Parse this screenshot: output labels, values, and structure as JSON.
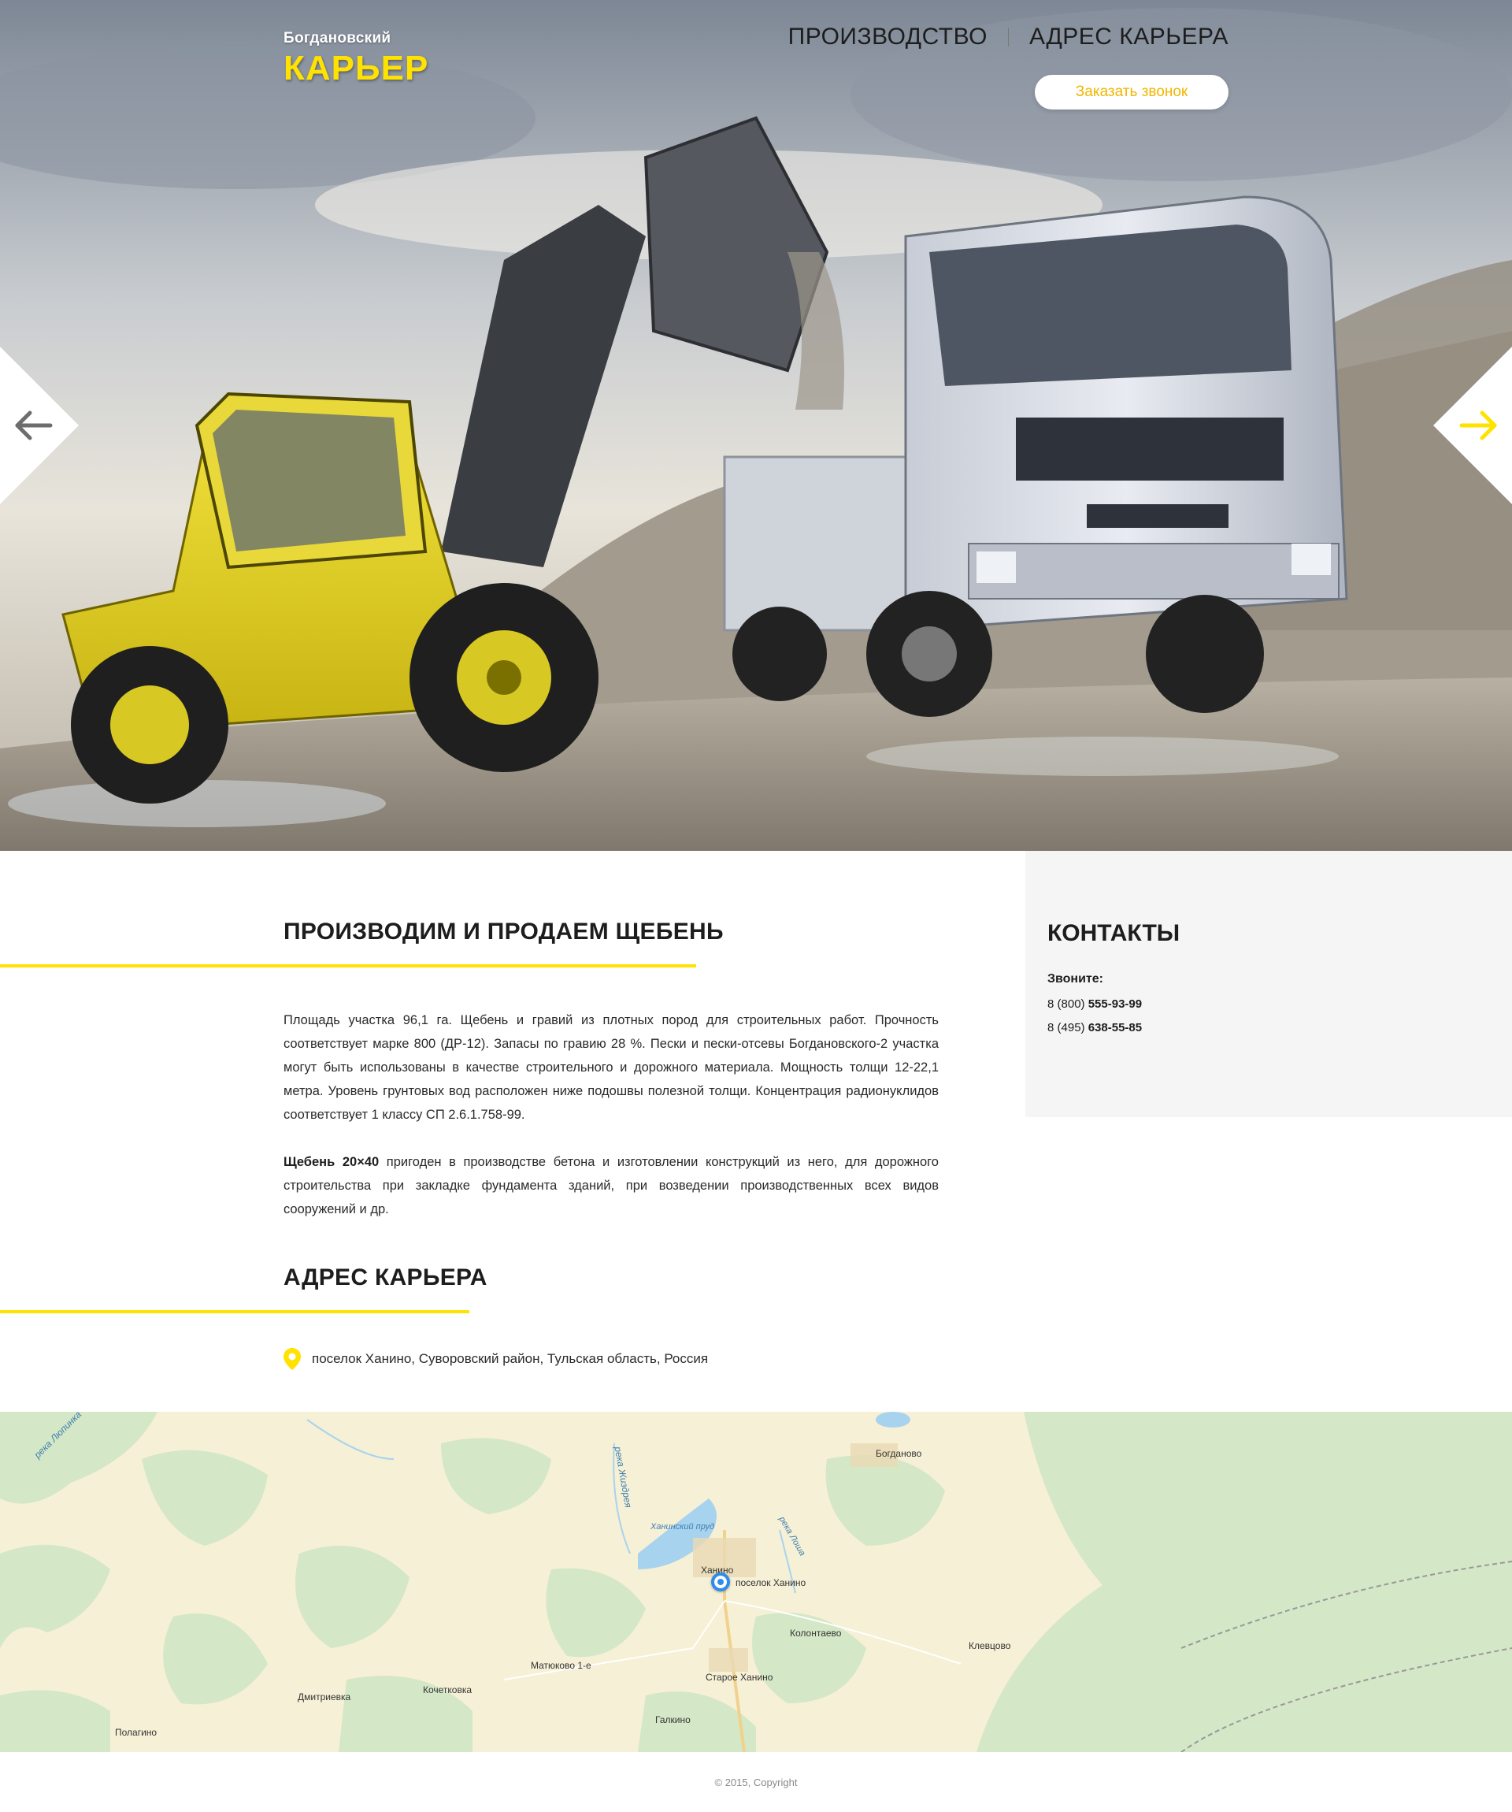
{
  "header": {
    "logo_top": "Богдановский",
    "logo_main": "КАРЬЕР",
    "nav": [
      {
        "label": "ПРОИЗВОДСТВО"
      },
      {
        "label": "АДРЕС КАРЬЕРА"
      }
    ],
    "call_button": "Заказать звонок"
  },
  "hero": {
    "left_arrow_icon": "arrow-left-icon",
    "right_arrow_icon": "arrow-right-icon"
  },
  "about": {
    "title": "ПРОИЗВОДИМ И ПРОДАЕМ ЩЕБЕНЬ",
    "paragraph1": "Площадь участка 96,1 га. Щебень и гравий из плотных пород для строительных работ. Прочность соответствует марке 800 (ДР-12). Запасы по гравию 28 %. Пески и пески-отсевы Богдановского-2 участка могут быть использованы в качестве строительного и дорожного материала. Мощность толщи 12-22,1 метра. Уровень грунтовых вод расположен ниже подошвы полезной толщи. Концентрация радионуклидов соответствует 1 классу СП 2.6.1.758-99.",
    "paragraph2_bold": "Щебень 20×40",
    "paragraph2_rest": " пригоден в производстве бетона и изготовлении конструкций из него, для дорожного строительства при закладке фундамента зданий, при возведении производственных всех видов сооружений и др."
  },
  "contacts": {
    "title": "КОНТАКТЫ",
    "label": "Звоните:",
    "phones": [
      {
        "prefix": "8 (800) ",
        "number": "555-93-99"
      },
      {
        "prefix": "8 (495) ",
        "number": "638-55-85"
      }
    ]
  },
  "address": {
    "title": "АДРЕС КАРЬЕРА",
    "text": "поселок Ханино, Суворовский район, Тульская область, Россия"
  },
  "map": {
    "labels": [
      "Богданово",
      "Ханино",
      "поселок Ханино",
      "Колонтаево",
      "Клевцово",
      "Матюково 1-е",
      "Старое Ханино",
      "Кочетковка",
      "Дмитриевка",
      "Галкино",
      "Полагино",
      "река Люпинка",
      "река Жиздрея",
      "Ханинский пруд",
      "река Лоша"
    ],
    "colors": {
      "land": "#f6f0d6",
      "forest": "#d4e7c6",
      "water": "#a8d3ee",
      "marker": "#2d8cf0"
    }
  },
  "footer": {
    "copyright": "© 2015, Copyright"
  },
  "colors": {
    "accent": "#ffe200",
    "button_text": "#f2b600",
    "panel_bg": "#f5f5f5"
  }
}
